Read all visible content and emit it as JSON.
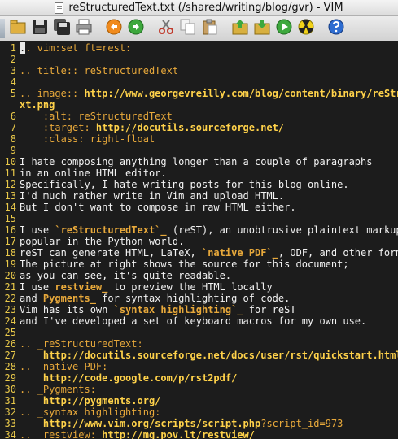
{
  "window": {
    "title": "reStructuredText.txt (/shared/writing/blog/gvr) - VIM"
  },
  "toolbar": {
    "buttons": [
      {
        "name": "open-icon"
      },
      {
        "name": "save-icon"
      },
      {
        "name": "save-all-icon"
      },
      {
        "name": "print-icon"
      },
      {
        "sep": true
      },
      {
        "name": "undo-icon"
      },
      {
        "name": "redo-icon"
      },
      {
        "sep": true
      },
      {
        "name": "cut-icon"
      },
      {
        "name": "copy-icon"
      },
      {
        "name": "paste-icon"
      },
      {
        "sep": true
      },
      {
        "name": "load-session-icon"
      },
      {
        "name": "save-session-icon"
      },
      {
        "name": "run-script-icon"
      },
      {
        "name": "make-icon"
      },
      {
        "sep": true
      },
      {
        "name": "help-icon"
      }
    ]
  },
  "editor": {
    "colors": {
      "background": "#1c1c1c",
      "line_number": "#e9c94a",
      "text": "#f2f2f2",
      "comment": "#e8a93b",
      "url": "#ffd24a"
    },
    "lines": [
      {
        "n": "1",
        "segs": [
          {
            "t": ".",
            "c": "cursor-block"
          },
          {
            "t": ". vim:set ft=rest:",
            "c": "seg-comment"
          }
        ]
      },
      {
        "n": "2",
        "segs": []
      },
      {
        "n": "3",
        "segs": [
          {
            "t": ".. title:: reStructuredText",
            "c": "seg-comment"
          }
        ]
      },
      {
        "n": "4",
        "segs": []
      },
      {
        "n": "5",
        "segs": [
          {
            "t": ".. image:: ",
            "c": "seg-comment"
          },
          {
            "t": "http://www.georgevreilly.com/blog/content/binary/reStru",
            "c": "seg-url"
          }
        ]
      },
      {
        "n": "",
        "segs": [
          {
            "t": "xt.png",
            "c": "seg-url"
          }
        ]
      },
      {
        "n": "6",
        "segs": [
          {
            "t": "    :alt: reStructuredText",
            "c": "seg-comment"
          }
        ]
      },
      {
        "n": "7",
        "segs": [
          {
            "t": "    :target: ",
            "c": "seg-comment"
          },
          {
            "t": "http://docutils.sourceforge.net/",
            "c": "seg-url"
          }
        ]
      },
      {
        "n": "8",
        "segs": [
          {
            "t": "    :class: right-float",
            "c": "seg-comment"
          }
        ]
      },
      {
        "n": "9",
        "segs": []
      },
      {
        "n": "10",
        "segs": [
          {
            "t": "I hate composing anything longer than a couple of paragraphs",
            "c": "seg-normal"
          }
        ]
      },
      {
        "n": "11",
        "segs": [
          {
            "t": "in an online HTML editor.",
            "c": "seg-normal"
          }
        ]
      },
      {
        "n": "12",
        "segs": [
          {
            "t": "Specifically, I hate writing posts for this blog online.",
            "c": "seg-normal"
          }
        ]
      },
      {
        "n": "13",
        "segs": [
          {
            "t": "I'd much rather write in Vim and upload HTML.",
            "c": "seg-normal"
          }
        ]
      },
      {
        "n": "14",
        "segs": [
          {
            "t": "But I don't want to compose in raw HTML either.",
            "c": "seg-normal"
          }
        ]
      },
      {
        "n": "15",
        "segs": []
      },
      {
        "n": "16",
        "segs": [
          {
            "t": "I use ",
            "c": "seg-normal"
          },
          {
            "t": "`reStructuredText`_",
            "c": "seg-ref"
          },
          {
            "t": " (reST), an unobtrusive plaintext markup l",
            "c": "seg-normal"
          }
        ]
      },
      {
        "n": "17",
        "segs": [
          {
            "t": "popular in the Python world.",
            "c": "seg-normal"
          }
        ]
      },
      {
        "n": "18",
        "segs": [
          {
            "t": "reST can generate HTML, LaTeX, ",
            "c": "seg-normal"
          },
          {
            "t": "`native PDF`_",
            "c": "seg-ref"
          },
          {
            "t": ", ODF, and other format",
            "c": "seg-normal"
          }
        ]
      },
      {
        "n": "19",
        "segs": [
          {
            "t": "The picture at right shows the source for this document;",
            "c": "seg-normal"
          }
        ]
      },
      {
        "n": "20",
        "segs": [
          {
            "t": "as you can see, it's quite readable.",
            "c": "seg-normal"
          }
        ]
      },
      {
        "n": "21",
        "segs": [
          {
            "t": "I use ",
            "c": "seg-normal"
          },
          {
            "t": "restview_",
            "c": "seg-ref"
          },
          {
            "t": " to preview the HTML locally",
            "c": "seg-normal"
          }
        ]
      },
      {
        "n": "22",
        "segs": [
          {
            "t": "and ",
            "c": "seg-normal"
          },
          {
            "t": "Pygments_",
            "c": "seg-ref"
          },
          {
            "t": " for syntax highlighting of code.",
            "c": "seg-normal"
          }
        ]
      },
      {
        "n": "23",
        "segs": [
          {
            "t": "Vim has its own ",
            "c": "seg-normal"
          },
          {
            "t": "`syntax highlighting`_",
            "c": "seg-ref"
          },
          {
            "t": " for reST",
            "c": "seg-normal"
          }
        ]
      },
      {
        "n": "24",
        "segs": [
          {
            "t": "and I've developed a set of keyboard macros for my own use.",
            "c": "seg-normal"
          }
        ]
      },
      {
        "n": "25",
        "segs": []
      },
      {
        "n": "26",
        "segs": [
          {
            "t": ".. _reStructuredText:",
            "c": "seg-comment"
          }
        ]
      },
      {
        "n": "27",
        "segs": [
          {
            "t": "    ",
            "c": "seg-normal"
          },
          {
            "t": "http://docutils.sourceforge.net/docs/user/rst/quickstart.html",
            "c": "seg-url"
          }
        ]
      },
      {
        "n": "28",
        "segs": [
          {
            "t": ".. _native PDF:",
            "c": "seg-comment"
          }
        ]
      },
      {
        "n": "29",
        "segs": [
          {
            "t": "    ",
            "c": "seg-normal"
          },
          {
            "t": "http://code.google.com/p/rst2pdf/",
            "c": "seg-url"
          }
        ]
      },
      {
        "n": "30",
        "segs": [
          {
            "t": ".. _Pygments:",
            "c": "seg-comment"
          }
        ]
      },
      {
        "n": "31",
        "segs": [
          {
            "t": "    ",
            "c": "seg-normal"
          },
          {
            "t": "http://pygments.org/",
            "c": "seg-url"
          }
        ]
      },
      {
        "n": "32",
        "segs": [
          {
            "t": ".. _syntax highlighting:",
            "c": "seg-comment"
          }
        ]
      },
      {
        "n": "33",
        "segs": [
          {
            "t": "    ",
            "c": "seg-normal"
          },
          {
            "t": "http://www.vim.org/scripts/script.php",
            "c": "seg-url"
          },
          {
            "t": "?script_id=973",
            "c": "seg-comment"
          }
        ]
      },
      {
        "n": "34",
        "segs": [
          {
            "t": ".. _restview: ",
            "c": "seg-comment"
          },
          {
            "t": "http://mg.pov.lt/restview/",
            "c": "seg-url"
          }
        ]
      }
    ]
  }
}
